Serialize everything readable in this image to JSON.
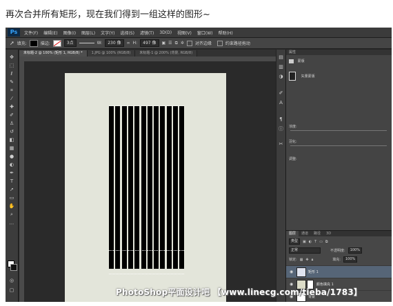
{
  "caption": "再次合并所有矩形，现在我们得到一组这样的图形~",
  "app": {
    "logo": "Ps",
    "menu": [
      "文件(F)",
      "编辑(E)",
      "图像(I)",
      "图层(L)",
      "文字(Y)",
      "选择(S)",
      "滤镜(T)",
      "3D(D)",
      "视图(V)",
      "窗口(W)",
      "帮助(H)"
    ]
  },
  "options_bar": {
    "tool_icon": "path-select-icon",
    "fill_label": "填充:",
    "stroke_label": "描边:",
    "stroke_size": "3点",
    "w_label": "W:",
    "w_value": "230 像",
    "h_label": "H:",
    "h_value": "497 像",
    "align_edges": "对齐边缘",
    "constrain_path": "约束路径拖动"
  },
  "tabs": [
    {
      "label": "未标题-2 @ 100% (矩形 1, RGB/8) *",
      "active": true
    },
    {
      "label": "1.JPG @ 100% (RGB/8)",
      "active": false
    },
    {
      "label": "未标题-1 @ 200% (背景, RGB/8)",
      "active": false
    }
  ],
  "tools": [
    "move",
    "marquee",
    "lasso",
    "quick-select",
    "crop",
    "eyedropper",
    "heal",
    "brush",
    "stamp",
    "history-brush",
    "eraser",
    "gradient",
    "blur",
    "dodge",
    "pen",
    "type",
    "path-select",
    "shape",
    "hand",
    "zoom"
  ],
  "shape": {
    "bar_count": 12,
    "fill": "#000000",
    "canvas_color": "#e3e5da"
  },
  "watermark": "PhotoShop平面设计吧 【www.linecg.com/tieba/1783】",
  "properties": {
    "title": "属性",
    "subtitle": "蒙版",
    "mask_label": "矢量蒙版",
    "density_label": "浓度:",
    "feather_label": "羽化:",
    "adjust_label": "调整:"
  },
  "layers": {
    "tabs": [
      "图层",
      "通道",
      "路径",
      "3D"
    ],
    "filter_label": "类型",
    "blend_mode": "正常",
    "opacity_label": "不透明度:",
    "opacity_value": "100%",
    "lock_label": "锁定:",
    "fill_label": "填充:",
    "fill_value": "100%",
    "items": [
      {
        "name": "矩形 1",
        "selected": true
      },
      {
        "name": "颜色填充 1",
        "selected": false
      },
      {
        "name": "背景",
        "selected": false
      }
    ]
  }
}
